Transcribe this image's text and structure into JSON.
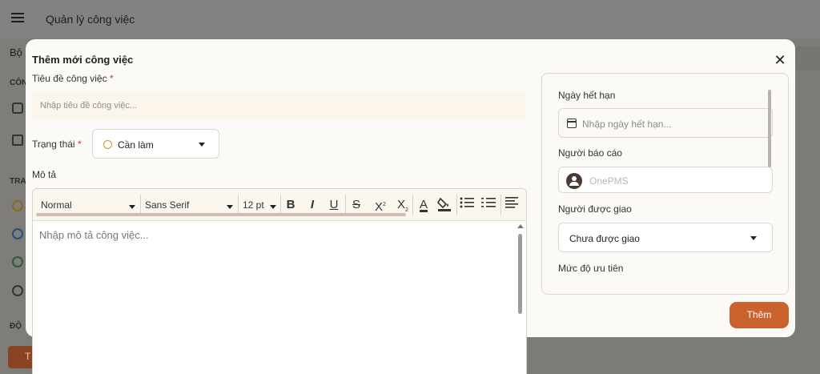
{
  "app": {
    "title": "Quản lý công việc",
    "bg_tab_label": "Bộ",
    "bg_section_1": "CÔN",
    "bg_section_2": "TRA",
    "bg_section_3": "ĐỘ",
    "bg_button_label": "T"
  },
  "dialog": {
    "title": "Thêm mới công việc",
    "title_field": {
      "label": "Tiêu đề công việc",
      "required_mark": "*",
      "placeholder": "Nhập tiêu đề công việc..."
    },
    "status": {
      "label": "Trạng thái",
      "required_mark": "*",
      "value": "Cần làm"
    },
    "description": {
      "label": "Mô tả",
      "placeholder": "Nhập mô tả công việc...",
      "toolbar": {
        "format": "Normal",
        "font": "Sans Serif",
        "size": "12 pt",
        "bold": "B",
        "italic": "I",
        "underline": "U",
        "strike": "S",
        "superscript": "X",
        "subscript": "X",
        "font_color": "A"
      }
    },
    "side_panel": {
      "due_date": {
        "label": "Ngày hết hạn",
        "placeholder": "Nhập ngày hết hạn..."
      },
      "reporter": {
        "label": "Người báo cáo",
        "value": "OnePMS"
      },
      "assignee": {
        "label": "Người được giao",
        "value": "Chưa được giao"
      },
      "priority": {
        "label": "Mức độ ưu tiên"
      }
    },
    "submit_label": "Thêm"
  },
  "colors": {
    "accent": "#c9622c",
    "status_todo": "#c89a1e"
  }
}
